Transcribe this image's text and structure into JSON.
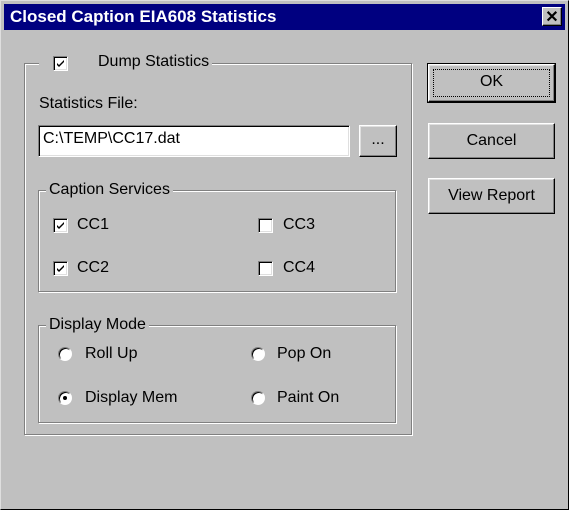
{
  "window": {
    "title": "Closed Caption EIA608 Statistics",
    "close_glyph": "✕"
  },
  "dump_statistics": {
    "label": "Dump Statistics",
    "checked": true
  },
  "statistics_file": {
    "label": "Statistics File:",
    "value": "C:\\TEMP\\CC17.dat",
    "browse_label": "..."
  },
  "caption_services": {
    "legend": "Caption Services",
    "items": [
      {
        "label": "CC1",
        "checked": true
      },
      {
        "label": "CC3",
        "checked": false
      },
      {
        "label": "CC2",
        "checked": true
      },
      {
        "label": "CC4",
        "checked": false
      }
    ]
  },
  "display_mode": {
    "legend": "Display Mode",
    "options": [
      {
        "label": "Roll Up",
        "selected": false
      },
      {
        "label": "Pop On",
        "selected": false
      },
      {
        "label": "Display Mem",
        "selected": true
      },
      {
        "label": "Paint On",
        "selected": false
      }
    ]
  },
  "buttons": {
    "ok": "OK",
    "cancel": "Cancel",
    "view_report": "View Report"
  },
  "colors": {
    "titlebar": "#000080",
    "face": "#c0c0c0"
  }
}
